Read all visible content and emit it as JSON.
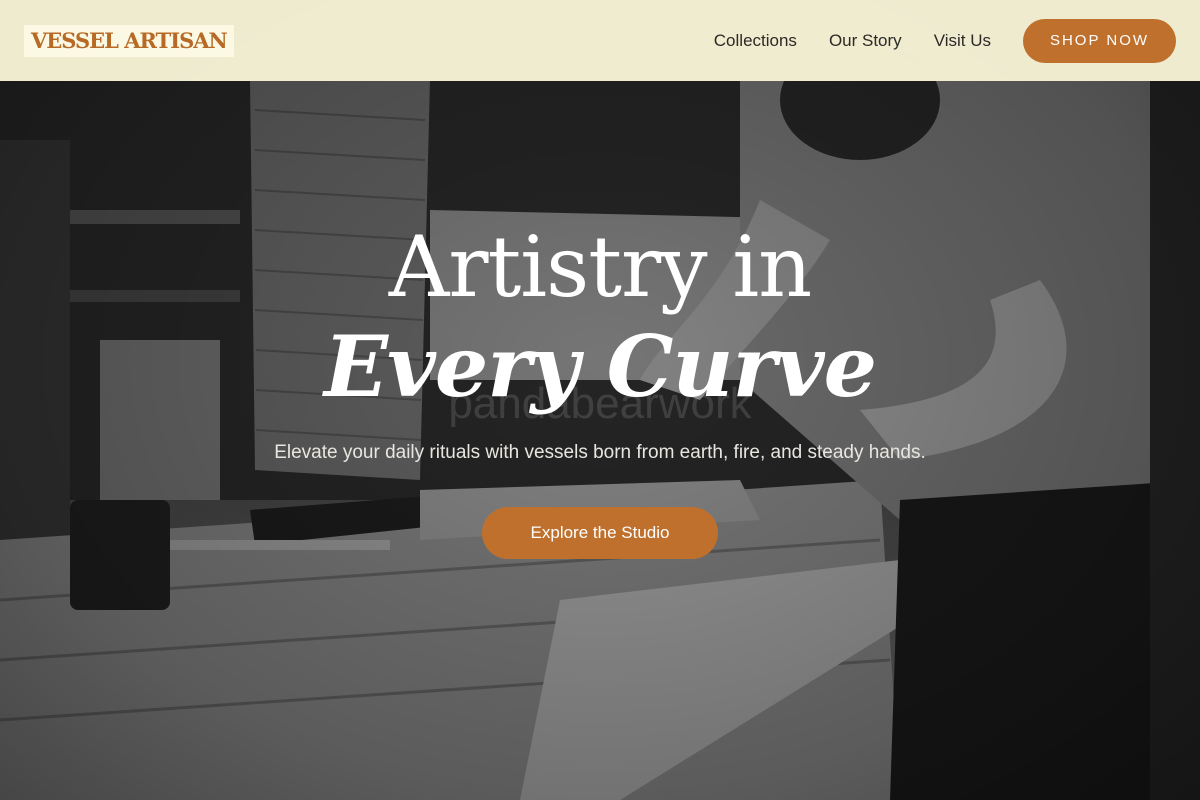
{
  "header": {
    "logo_text": "VESSEL ARTISAN",
    "nav": [
      {
        "label": "Collections"
      },
      {
        "label": "Our Story"
      },
      {
        "label": "Visit Us"
      }
    ],
    "shop_button": "SHOP NOW"
  },
  "hero": {
    "headline_line1": "Artistry in",
    "headline_line2": "Every Curve",
    "watermark": "pandabearwork",
    "subtitle": "Elevate your daily rituals with vessels born from earth, fire, and steady hands.",
    "cta_button": "Explore the Studio"
  },
  "colors": {
    "accent": "#c0702d",
    "header_bg": "#f6f3d6",
    "logo": "#b76a25"
  }
}
